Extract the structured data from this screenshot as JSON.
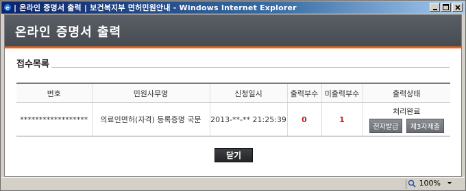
{
  "window": {
    "title": "| 온라인 증명서 출력 | 보건복지부 면허민원안내 - Windows Internet Explorer"
  },
  "header": {
    "title": "온라인 증명서 출력"
  },
  "section": {
    "title": "접수목록"
  },
  "table": {
    "columns": [
      "번호",
      "민원사무명",
      "신청일시",
      "출력부수",
      "미출력부수",
      "출력상태"
    ],
    "rows": [
      {
        "number": "******************",
        "service": "의료인면허(자격) 등록증명 국문",
        "date": "2013-**-** 21:25:39",
        "printed": "0",
        "unprinted": "1",
        "status": "처리완료",
        "btn_electronic": "전자발급",
        "btn_third_party": "제3자제출"
      }
    ]
  },
  "close_button": {
    "label": "닫기"
  },
  "statusbar": {
    "zoom": "100%"
  },
  "colors": {
    "accent": "#e8641b",
    "header_bg": "#4f545b",
    "red": "#c8201b"
  }
}
